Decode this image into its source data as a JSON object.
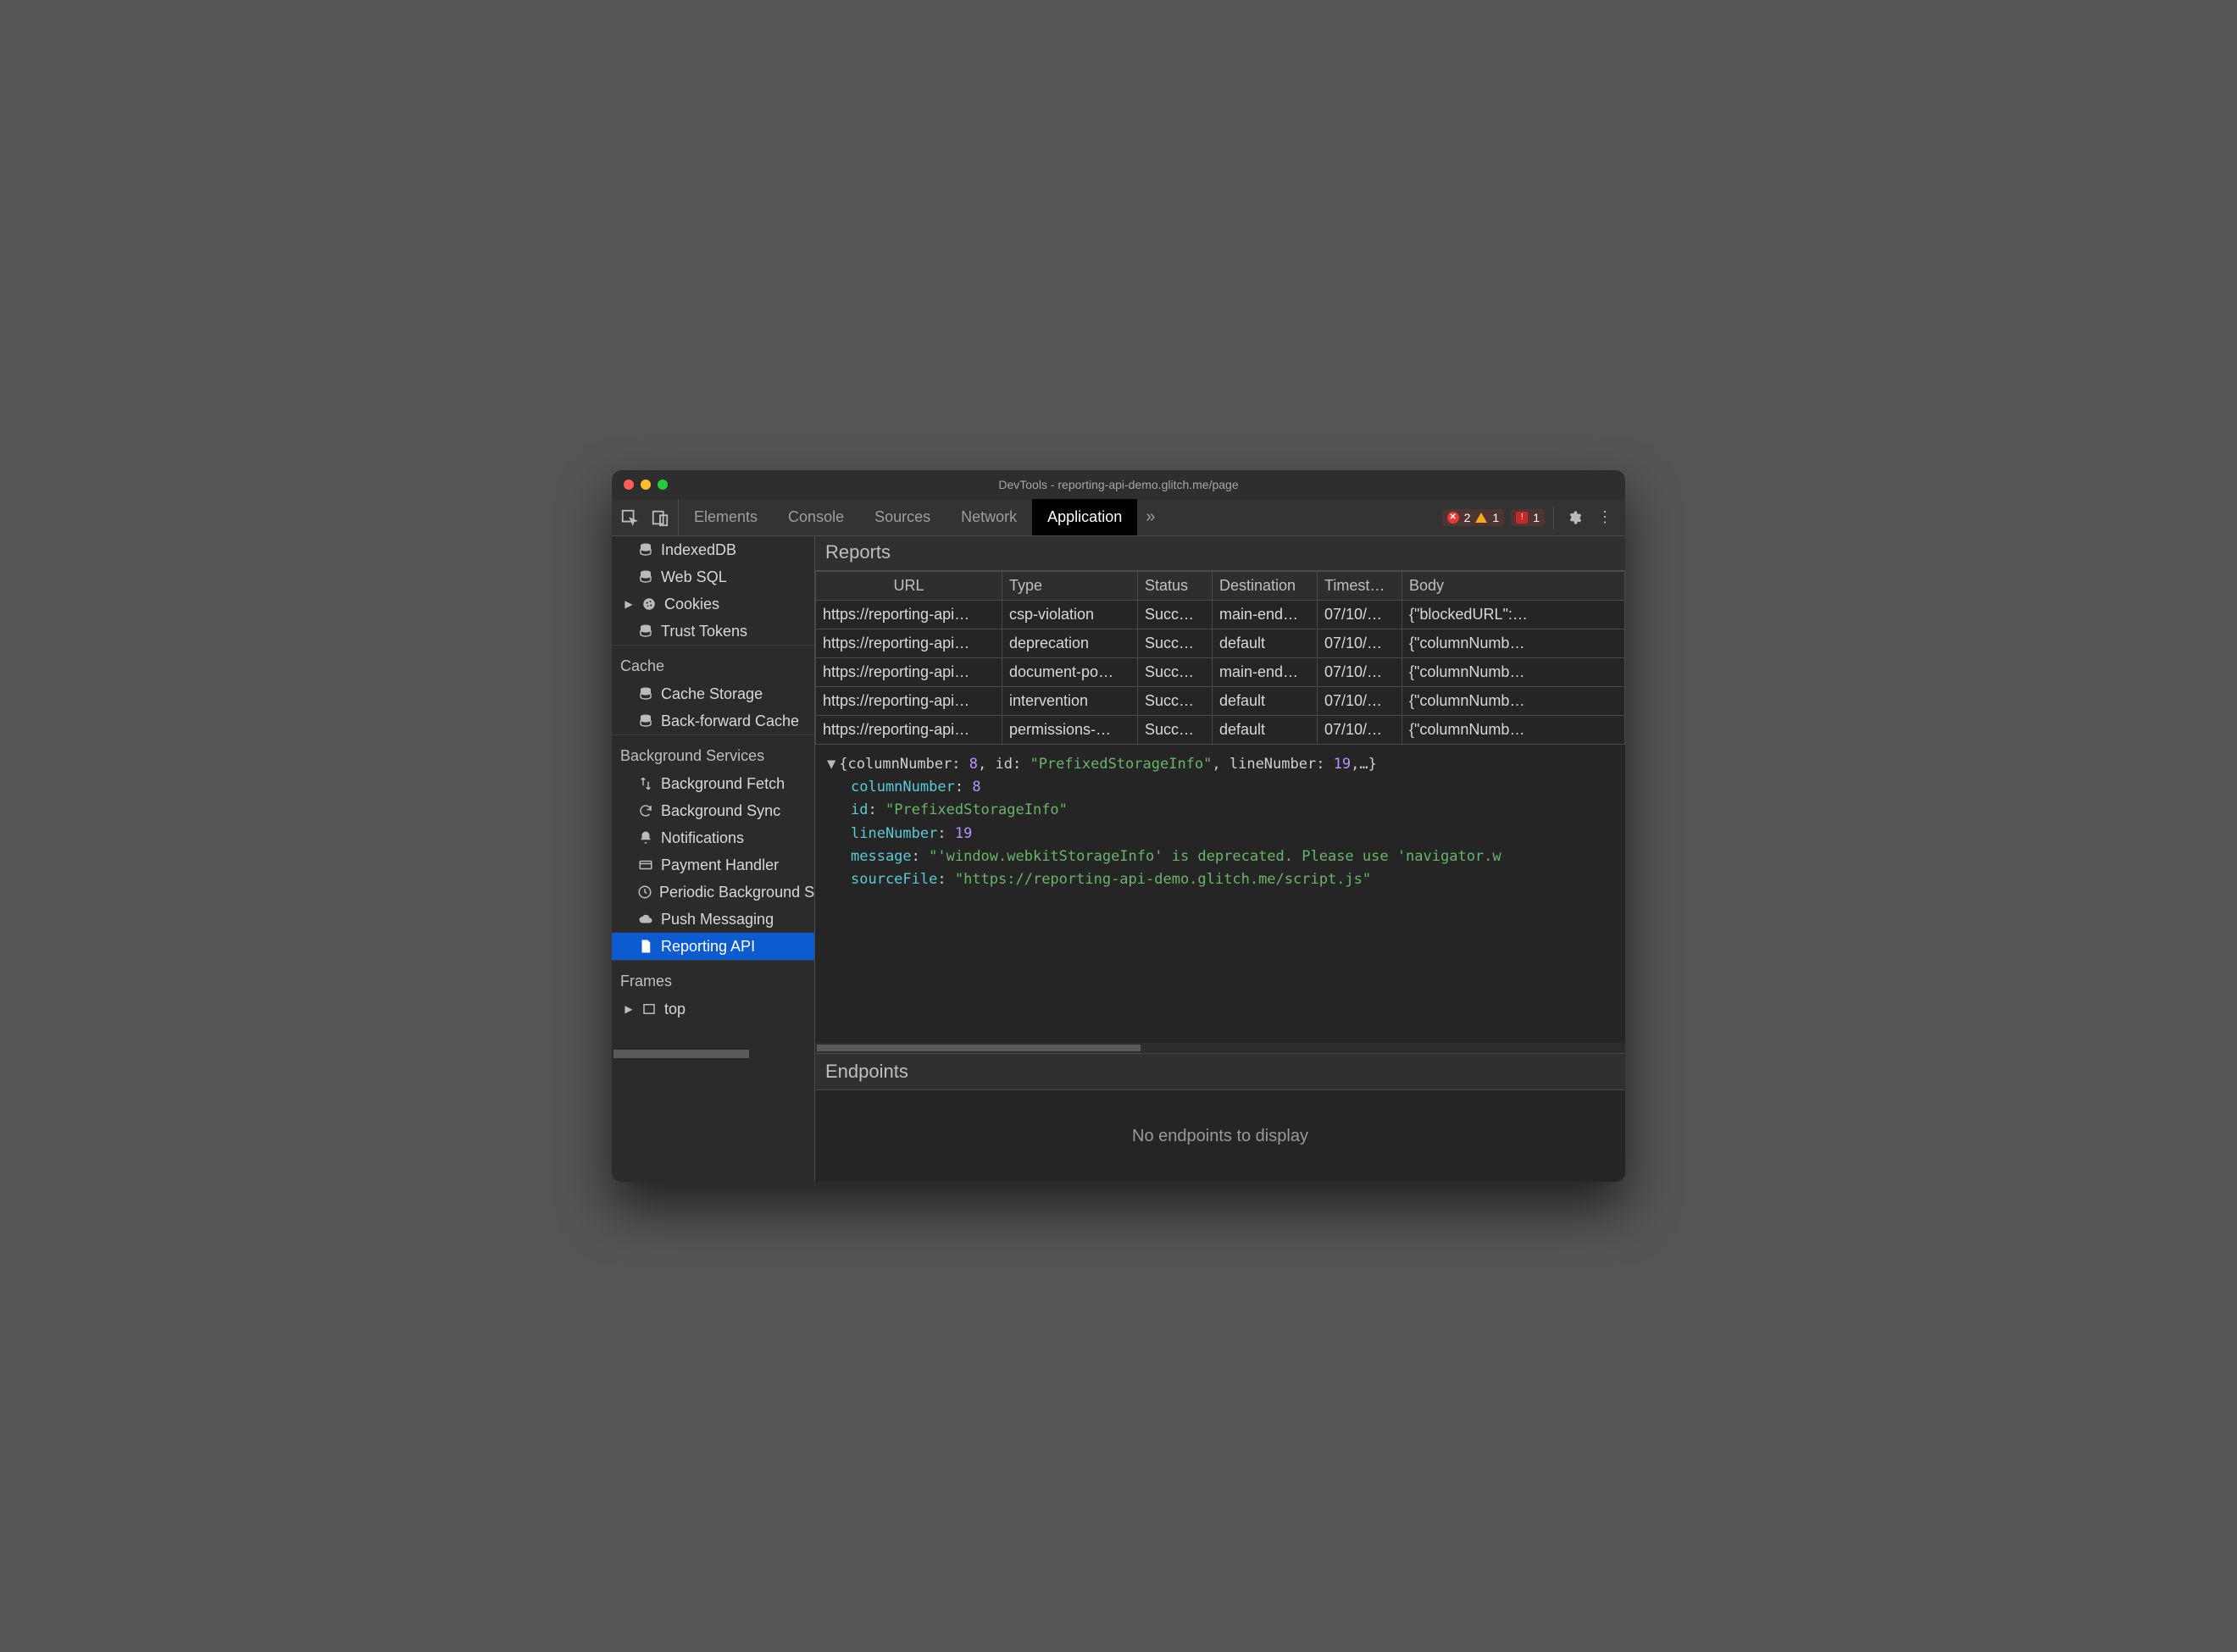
{
  "window_title": "DevTools - reporting-api-demo.glitch.me/page",
  "tabs": [
    "Elements",
    "Console",
    "Sources",
    "Network",
    "Application"
  ],
  "active_tab": "Application",
  "error_count": "2",
  "warning_count": "1",
  "issue_count": "1",
  "sidebar": {
    "storage_items": [
      {
        "icon": "db",
        "label": "IndexedDB",
        "expandable": false
      },
      {
        "icon": "db",
        "label": "Web SQL",
        "expandable": false
      },
      {
        "icon": "cookie",
        "label": "Cookies",
        "expandable": true
      },
      {
        "icon": "db",
        "label": "Trust Tokens",
        "expandable": false
      }
    ],
    "cache_title": "Cache",
    "cache_items": [
      {
        "icon": "db",
        "label": "Cache Storage"
      },
      {
        "icon": "db",
        "label": "Back-forward Cache"
      }
    ],
    "bg_title": "Background Services",
    "bg_items": [
      {
        "icon": "updown",
        "label": "Background Fetch"
      },
      {
        "icon": "sync",
        "label": "Background Sync"
      },
      {
        "icon": "bell",
        "label": "Notifications"
      },
      {
        "icon": "card",
        "label": "Payment Handler"
      },
      {
        "icon": "clock",
        "label": "Periodic Background Sync"
      },
      {
        "icon": "cloud",
        "label": "Push Messaging"
      },
      {
        "icon": "doc",
        "label": "Reporting API",
        "selected": true
      }
    ],
    "frames_title": "Frames",
    "frames_items": [
      {
        "icon": "frame",
        "label": "top",
        "expandable": true
      }
    ]
  },
  "reports": {
    "title": "Reports",
    "columns": [
      "URL",
      "Type",
      "Status",
      "Destination",
      "Timest…",
      "Body"
    ],
    "rows": [
      {
        "url": "https://reporting-api…",
        "type": "csp-violation",
        "status": "Succ…",
        "dest": "main-end…",
        "ts": "07/10/…",
        "body": "{\"blockedURL\":…"
      },
      {
        "url": "https://reporting-api…",
        "type": "deprecation",
        "status": "Succ…",
        "dest": "default",
        "ts": "07/10/…",
        "body": "{\"columnNumb…"
      },
      {
        "url": "https://reporting-api…",
        "type": "document-po…",
        "status": "Succ…",
        "dest": "main-end…",
        "ts": "07/10/…",
        "body": "{\"columnNumb…"
      },
      {
        "url": "https://reporting-api…",
        "type": "intervention",
        "status": "Succ…",
        "dest": "default",
        "ts": "07/10/…",
        "body": "{\"columnNumb…"
      },
      {
        "url": "https://reporting-api…",
        "type": "permissions-…",
        "status": "Succ…",
        "dest": "default",
        "ts": "07/10/…",
        "body": "{\"columnNumb…"
      }
    ]
  },
  "detail": {
    "summary_a": "{columnNumber: ",
    "summary_colnum": "8",
    "summary_b": ", id: ",
    "summary_id": "\"PrefixedStorageInfo\"",
    "summary_c": ", lineNumber: ",
    "summary_linenum": "19",
    "summary_d": ",…}",
    "columnNumber": "8",
    "id": "\"PrefixedStorageInfo\"",
    "lineNumber": "19",
    "message": "\"'window.webkitStorageInfo' is deprecated. Please use 'navigator.w",
    "sourceFile": "\"https://reporting-api-demo.glitch.me/script.js\"",
    "k_columnNumber": "columnNumber",
    "k_id": "id",
    "k_lineNumber": "lineNumber",
    "k_message": "message",
    "k_sourceFile": "sourceFile"
  },
  "endpoints": {
    "title": "Endpoints",
    "empty": "No endpoints to display"
  }
}
